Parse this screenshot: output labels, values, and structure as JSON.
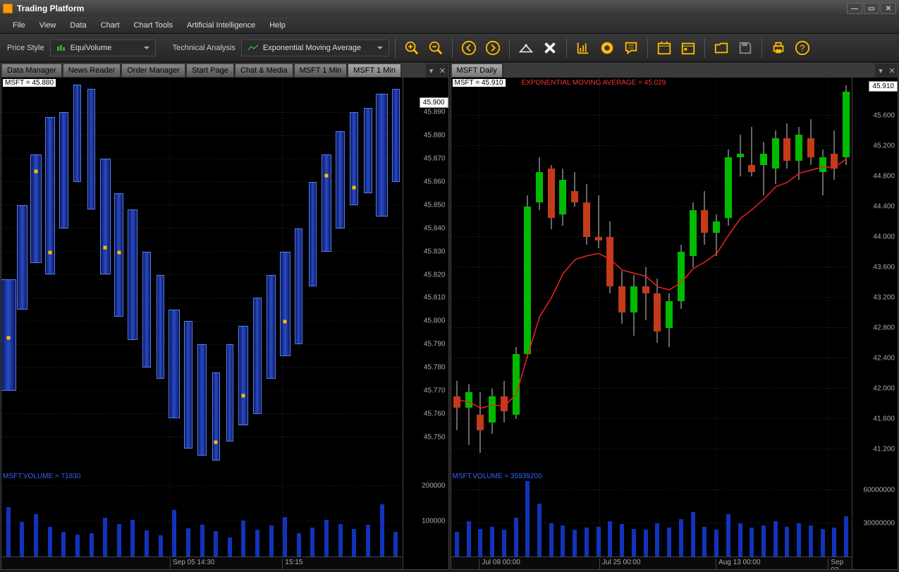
{
  "titlebar": {
    "title": "Trading Platform"
  },
  "menubar": {
    "items": [
      "File",
      "View",
      "Data",
      "Chart",
      "Chart Tools",
      "Artificial Intelligence",
      "Help"
    ]
  },
  "toolbar": {
    "price_style_label": "Price Style",
    "price_style_value": "EquiVolume",
    "ta_label": "Technical Analysis",
    "ta_value": "Exponential Moving Average"
  },
  "left": {
    "tabs": [
      "Data Manager",
      "News Reader",
      "Order Manager",
      "Start Page",
      "Chat & Media",
      "MSFT 1 Min",
      "MSFT 1 Min"
    ],
    "active_tab_index": 6,
    "symbol_label": "MSFT = 45.880",
    "current_price": "45.900",
    "volume_label": "MSFT.VOLUME = 71830",
    "yaxis": [
      "45.890",
      "45.880",
      "45.870",
      "45.860",
      "45.850",
      "45.840",
      "45.830",
      "45.820",
      "45.810",
      "45.800",
      "45.790",
      "45.780",
      "45.770",
      "45.760",
      "45.750"
    ],
    "volume_yaxis": [
      "200000",
      "100000"
    ],
    "xaxis": [
      "Sep 05 14:30",
      "15:15"
    ]
  },
  "right": {
    "tab": "MSFT Daily",
    "symbol_label": "MSFT = 45.910",
    "ema_label": "EXPONENTIAL MOVING AVERAGE = 45.029",
    "current_price": "45.910",
    "volume_label": "MSFT.VOLUME = 35939200",
    "yaxis": [
      "45.600",
      "45.200",
      "44.800",
      "44.400",
      "44.000",
      "43.600",
      "43.200",
      "42.800",
      "42.400",
      "42.000",
      "41.600",
      "41.200"
    ],
    "volume_yaxis": [
      "60000000",
      "30000000"
    ],
    "xaxis": [
      "Jul 08 00:00",
      "Jul 25 00:00",
      "Aug 13 00:00",
      "Sep 02 00:00"
    ]
  },
  "chart_data": [
    {
      "type": "ohlc",
      "panel": "left",
      "title": "MSFT 1 Min — EquiVolume",
      "ylim": [
        45.74,
        45.9
      ],
      "xticks": [
        "Sep 05 14:30",
        "15:15"
      ],
      "note": "EquiVolume bars — bar width encodes relative volume; y positions are price ranges estimated from axis.",
      "bars": [
        {
          "i": 0,
          "low": 45.77,
          "high": 45.818,
          "rel_width": 1.8,
          "marker": 45.793
        },
        {
          "i": 1,
          "low": 45.805,
          "high": 45.85,
          "rel_width": 1.2
        },
        {
          "i": 2,
          "low": 45.825,
          "high": 45.872,
          "rel_width": 1.3,
          "marker": 45.865
        },
        {
          "i": 3,
          "low": 45.82,
          "high": 45.888,
          "rel_width": 1.0,
          "marker": 45.83
        },
        {
          "i": 4,
          "low": 45.84,
          "high": 45.89,
          "rel_width": 0.9
        },
        {
          "i": 5,
          "low": 45.86,
          "high": 45.902,
          "rel_width": 0.7
        },
        {
          "i": 6,
          "low": 45.848,
          "high": 45.9,
          "rel_width": 0.7
        },
        {
          "i": 7,
          "low": 45.82,
          "high": 45.87,
          "rel_width": 1.1,
          "marker": 45.832
        },
        {
          "i": 8,
          "low": 45.802,
          "high": 45.855,
          "rel_width": 0.9,
          "marker": 45.83
        },
        {
          "i": 9,
          "low": 45.792,
          "high": 45.848,
          "rel_width": 1.0
        },
        {
          "i": 10,
          "low": 45.78,
          "high": 45.83,
          "rel_width": 0.8
        },
        {
          "i": 11,
          "low": 45.775,
          "high": 45.82,
          "rel_width": 0.7
        },
        {
          "i": 12,
          "low": 45.758,
          "high": 45.805,
          "rel_width": 1.2
        },
        {
          "i": 13,
          "low": 45.745,
          "high": 45.8,
          "rel_width": 0.8
        },
        {
          "i": 14,
          "low": 45.742,
          "high": 45.79,
          "rel_width": 0.9
        },
        {
          "i": 15,
          "low": 45.74,
          "high": 45.778,
          "rel_width": 0.7,
          "marker": 45.748
        },
        {
          "i": 16,
          "low": 45.748,
          "high": 45.79,
          "rel_width": 0.6
        },
        {
          "i": 17,
          "low": 45.755,
          "high": 45.798,
          "rel_width": 1.0,
          "marker": 45.768
        },
        {
          "i": 18,
          "low": 45.76,
          "high": 45.81,
          "rel_width": 0.8
        },
        {
          "i": 19,
          "low": 45.775,
          "high": 45.82,
          "rel_width": 0.9
        },
        {
          "i": 20,
          "low": 45.785,
          "high": 45.83,
          "rel_width": 1.1,
          "marker": 45.8
        },
        {
          "i": 21,
          "low": 45.79,
          "high": 45.84,
          "rel_width": 0.7
        },
        {
          "i": 22,
          "low": 45.815,
          "high": 45.86,
          "rel_width": 0.8
        },
        {
          "i": 23,
          "low": 45.83,
          "high": 45.872,
          "rel_width": 1.0,
          "marker": 45.863
        },
        {
          "i": 24,
          "low": 45.84,
          "high": 45.882,
          "rel_width": 0.9
        },
        {
          "i": 25,
          "low": 45.85,
          "high": 45.89,
          "rel_width": 0.8,
          "marker": 45.858
        },
        {
          "i": 26,
          "low": 45.855,
          "high": 45.892,
          "rel_width": 0.9
        },
        {
          "i": 27,
          "low": 45.845,
          "high": 45.898,
          "rel_width": 1.3
        },
        {
          "i": 28,
          "low": 45.86,
          "high": 45.9,
          "rel_width": 0.7
        }
      ],
      "volume_series": {
        "ylim": [
          0,
          220000
        ],
        "values": [
          140000,
          98000,
          120000,
          85000,
          70000,
          62000,
          66000,
          110000,
          92000,
          105000,
          74000,
          60000,
          132000,
          80000,
          90000,
          72000,
          54000,
          102000,
          76000,
          88000,
          112000,
          66000,
          82000,
          104000,
          92000,
          78000,
          90000,
          148000,
          71000
        ]
      }
    },
    {
      "type": "candlestick",
      "panel": "right",
      "title": "MSFT Daily",
      "ylim": [
        41.0,
        46.0
      ],
      "xticks": [
        "Jul 08 00:00",
        "Jul 25 00:00",
        "Aug 13 00:00",
        "Sep 02 00:00"
      ],
      "candles": [
        {
          "o": 41.9,
          "h": 42.1,
          "l": 41.45,
          "c": 41.75
        },
        {
          "o": 41.75,
          "h": 42.05,
          "l": 41.25,
          "c": 41.95
        },
        {
          "o": 41.65,
          "h": 41.95,
          "l": 41.15,
          "c": 41.45
        },
        {
          "o": 41.55,
          "h": 42.0,
          "l": 41.4,
          "c": 41.9
        },
        {
          "o": 41.9,
          "h": 42.1,
          "l": 41.55,
          "c": 41.7
        },
        {
          "o": 41.65,
          "h": 42.55,
          "l": 41.6,
          "c": 42.45
        },
        {
          "o": 42.45,
          "h": 44.55,
          "l": 42.4,
          "c": 44.4
        },
        {
          "o": 44.45,
          "h": 45.05,
          "l": 44.35,
          "c": 44.85
        },
        {
          "o": 44.9,
          "h": 44.95,
          "l": 44.1,
          "c": 44.25
        },
        {
          "o": 44.3,
          "h": 44.9,
          "l": 44.15,
          "c": 44.75
        },
        {
          "o": 44.6,
          "h": 44.85,
          "l": 44.4,
          "c": 44.45
        },
        {
          "o": 44.45,
          "h": 44.7,
          "l": 43.9,
          "c": 44.0
        },
        {
          "o": 44.0,
          "h": 44.55,
          "l": 43.85,
          "c": 43.95
        },
        {
          "o": 44.0,
          "h": 44.2,
          "l": 43.25,
          "c": 43.35
        },
        {
          "o": 43.35,
          "h": 43.55,
          "l": 42.85,
          "c": 43.0
        },
        {
          "o": 43.0,
          "h": 43.5,
          "l": 42.7,
          "c": 43.35
        },
        {
          "o": 43.35,
          "h": 43.6,
          "l": 42.9,
          "c": 43.25
        },
        {
          "o": 43.25,
          "h": 43.45,
          "l": 42.6,
          "c": 42.75
        },
        {
          "o": 42.8,
          "h": 43.25,
          "l": 42.55,
          "c": 43.15
        },
        {
          "o": 43.15,
          "h": 43.9,
          "l": 43.05,
          "c": 43.8
        },
        {
          "o": 43.75,
          "h": 44.45,
          "l": 43.6,
          "c": 44.35
        },
        {
          "o": 44.35,
          "h": 44.6,
          "l": 43.9,
          "c": 44.05
        },
        {
          "o": 44.05,
          "h": 44.3,
          "l": 43.75,
          "c": 44.2
        },
        {
          "o": 44.25,
          "h": 45.15,
          "l": 44.15,
          "c": 45.05
        },
        {
          "o": 45.05,
          "h": 45.35,
          "l": 44.8,
          "c": 45.1
        },
        {
          "o": 44.95,
          "h": 45.45,
          "l": 44.8,
          "c": 44.85
        },
        {
          "o": 44.95,
          "h": 45.25,
          "l": 44.55,
          "c": 45.1
        },
        {
          "o": 44.9,
          "h": 45.4,
          "l": 44.7,
          "c": 45.3
        },
        {
          "o": 45.3,
          "h": 45.5,
          "l": 44.9,
          "c": 45.0
        },
        {
          "o": 45.0,
          "h": 45.45,
          "l": 44.75,
          "c": 45.35
        },
        {
          "o": 45.3,
          "h": 45.55,
          "l": 44.95,
          "c": 45.05
        },
        {
          "o": 44.85,
          "h": 45.15,
          "l": 44.55,
          "c": 45.05
        },
        {
          "o": 45.1,
          "h": 45.4,
          "l": 44.75,
          "c": 44.9
        },
        {
          "o": 45.05,
          "h": 46.0,
          "l": 44.95,
          "c": 45.91
        }
      ],
      "ema": {
        "name": "Exponential Moving Average",
        "values": [
          41.85,
          41.82,
          41.74,
          41.78,
          41.77,
          41.92,
          42.45,
          42.95,
          43.2,
          43.52,
          43.7,
          43.75,
          43.78,
          43.7,
          43.56,
          43.52,
          43.48,
          43.34,
          43.3,
          43.4,
          43.58,
          43.67,
          43.78,
          44.02,
          44.24,
          44.36,
          44.5,
          44.66,
          44.72,
          44.84,
          44.88,
          44.92,
          44.92,
          45.03
        ]
      },
      "volume_series": {
        "ylim": [
          0,
          70000000
        ],
        "values": [
          22000000,
          32000000,
          25000000,
          27000000,
          24000000,
          35000000,
          68000000,
          48000000,
          30000000,
          28000000,
          24000000,
          26000000,
          27000000,
          32000000,
          29000000,
          25000000,
          24000000,
          30000000,
          26000000,
          34000000,
          40000000,
          27000000,
          24000000,
          38000000,
          30000000,
          26000000,
          28000000,
          32000000,
          27000000,
          30000000,
          28000000,
          25000000,
          26000000,
          36000000
        ]
      }
    }
  ]
}
